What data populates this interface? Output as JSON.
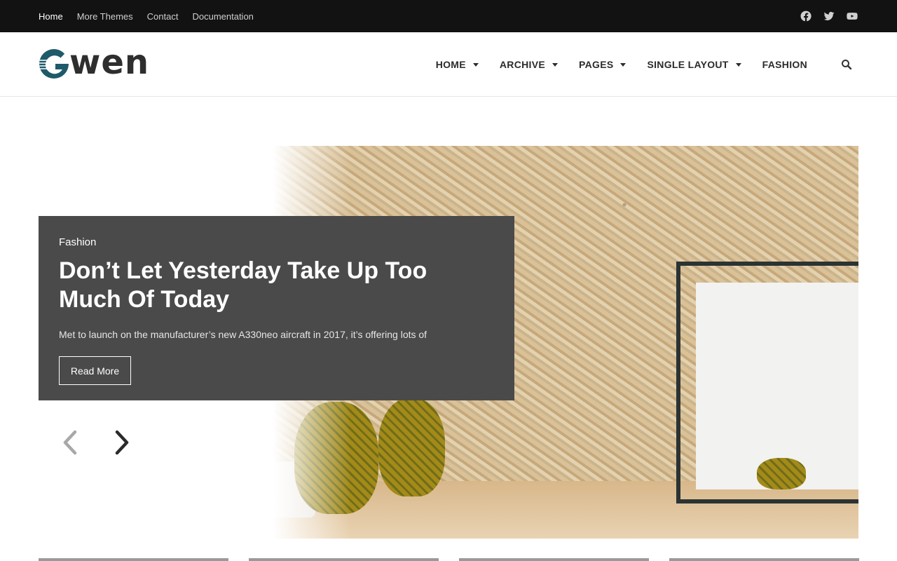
{
  "topbar": {
    "links": [
      {
        "label": "Home",
        "active": true
      },
      {
        "label": "More Themes",
        "active": false
      },
      {
        "label": "Contact",
        "active": false
      },
      {
        "label": "Documentation",
        "active": false
      }
    ],
    "social": [
      "facebook-icon",
      "twitter-icon",
      "youtube-icon"
    ]
  },
  "header": {
    "logo_text": "wen",
    "logo_mark": "G",
    "nav": [
      {
        "label": "HOME",
        "has_dropdown": true
      },
      {
        "label": "ARCHIVE",
        "has_dropdown": true
      },
      {
        "label": "PAGES",
        "has_dropdown": true
      },
      {
        "label": "SINGLE LAYOUT",
        "has_dropdown": true
      },
      {
        "label": "FASHION",
        "has_dropdown": false
      }
    ],
    "search_icon": "search-icon"
  },
  "slider": {
    "category": "Fashion",
    "title": "Don’t Let Yesterday Take Up Too Much Of Today",
    "excerpt": "Met to launch on the manufacturer’s new A330neo aircraft in 2017, it’s offering lots of",
    "button_label": "Read More",
    "prev_icon": "chevron-left-icon",
    "next_icon": "chevron-right-icon"
  },
  "colors": {
    "topbar_bg": "#121212",
    "post_box_bg": "#4a4a4a",
    "logo_accent": "#1e5a6a"
  }
}
